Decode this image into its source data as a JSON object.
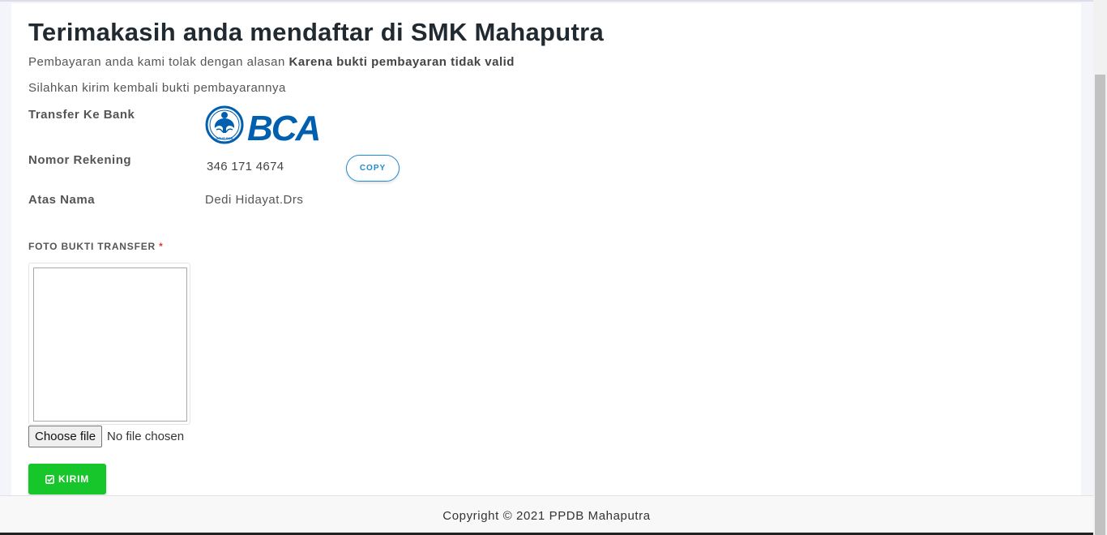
{
  "page": {
    "title": "Terimakasih anda mendaftar di SMK Mahaputra",
    "rejection_prefix": "Pembayaran anda kami tolak dengan alasan ",
    "rejection_reason": "Karena bukti pembayaran tidak valid",
    "resend_instruction": "Silahkan kirim kembali bukti pembayarannya"
  },
  "bank": {
    "transfer_label": "Transfer Ke Bank",
    "logo": {
      "icon": "bca-logo",
      "text": "BCA",
      "seal_text": "GRUP BCA",
      "color": "#0060af"
    },
    "account_label": "Nomor Rekening",
    "account_number": "346 171 4674",
    "copy_label": "COPY",
    "holder_label": "Atas Nama",
    "holder_name": "Dedi Hidayat.Drs"
  },
  "upload": {
    "label": "FOTO BUKTI TRANSFER",
    "required_mark": "*",
    "choose_file_label": "Choose file",
    "no_file_text": "No file chosen"
  },
  "submit": {
    "icon": "check-square-icon",
    "label": "KIRIM",
    "color": "#17c62a"
  },
  "footer": {
    "text": "Copyright © 2021 PPDB Mahaputra"
  }
}
